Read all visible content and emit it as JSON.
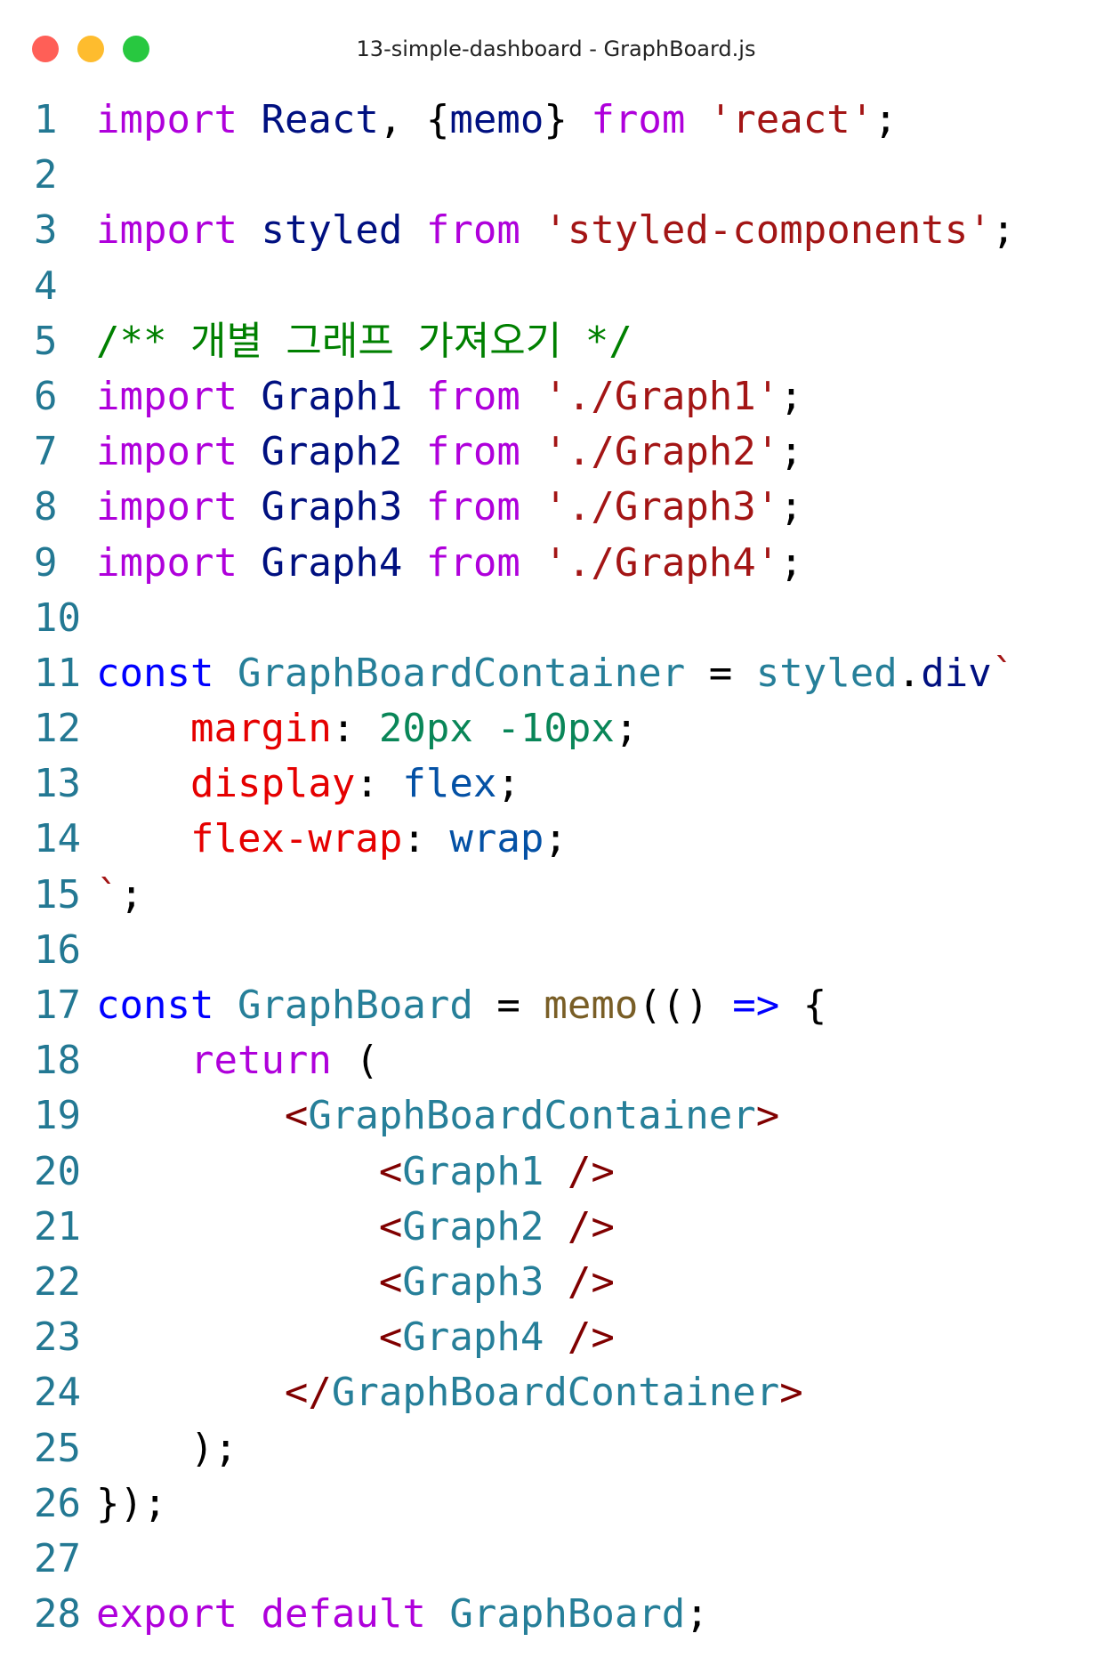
{
  "window": {
    "title": "13-simple-dashboard - GraphBoard.js",
    "controls": [
      {
        "name": "close-button",
        "color": "#FF5F57"
      },
      {
        "name": "minimize-button",
        "color": "#FEBC2E"
      },
      {
        "name": "maximize-button",
        "color": "#28C840"
      }
    ]
  },
  "colors": {
    "line_number": "#237893",
    "keyword": "#AF00DB",
    "declaration": "#0000FF",
    "identifier": "#001080",
    "component": "#267F99",
    "string": "#A31515",
    "comment": "#008000",
    "css_property": "#E50000",
    "css_value": "#0451A5",
    "number": "#098658",
    "function": "#795E26",
    "jsx_bracket": "#800000",
    "plain": "#000000"
  },
  "code_lines": [
    {
      "n": "1",
      "tokens": [
        [
          "import",
          "keyword"
        ],
        [
          " ",
          "plain"
        ],
        [
          "React",
          "identifier"
        ],
        [
          ", {",
          "plain"
        ],
        [
          "memo",
          "identifier"
        ],
        [
          "} ",
          "plain"
        ],
        [
          "from",
          "keyword"
        ],
        [
          " ",
          "plain"
        ],
        [
          "'react'",
          "string"
        ],
        [
          ";",
          "plain"
        ]
      ]
    },
    {
      "n": "2",
      "tokens": []
    },
    {
      "n": "3",
      "tokens": [
        [
          "import",
          "keyword"
        ],
        [
          " ",
          "plain"
        ],
        [
          "styled",
          "identifier"
        ],
        [
          " ",
          "plain"
        ],
        [
          "from",
          "keyword"
        ],
        [
          " ",
          "plain"
        ],
        [
          "'styled-components'",
          "string"
        ],
        [
          ";",
          "plain"
        ]
      ]
    },
    {
      "n": "4",
      "tokens": []
    },
    {
      "n": "5",
      "tokens": [
        [
          "/** 개별 그래프 가져오기 */",
          "comment"
        ]
      ]
    },
    {
      "n": "6",
      "tokens": [
        [
          "import",
          "keyword"
        ],
        [
          " ",
          "plain"
        ],
        [
          "Graph1",
          "identifier"
        ],
        [
          " ",
          "plain"
        ],
        [
          "from",
          "keyword"
        ],
        [
          " ",
          "plain"
        ],
        [
          "'./Graph1'",
          "string"
        ],
        [
          ";",
          "plain"
        ]
      ]
    },
    {
      "n": "7",
      "tokens": [
        [
          "import",
          "keyword"
        ],
        [
          " ",
          "plain"
        ],
        [
          "Graph2",
          "identifier"
        ],
        [
          " ",
          "plain"
        ],
        [
          "from",
          "keyword"
        ],
        [
          " ",
          "plain"
        ],
        [
          "'./Graph2'",
          "string"
        ],
        [
          ";",
          "plain"
        ]
      ]
    },
    {
      "n": "8",
      "tokens": [
        [
          "import",
          "keyword"
        ],
        [
          " ",
          "plain"
        ],
        [
          "Graph3",
          "identifier"
        ],
        [
          " ",
          "plain"
        ],
        [
          "from",
          "keyword"
        ],
        [
          " ",
          "plain"
        ],
        [
          "'./Graph3'",
          "string"
        ],
        [
          ";",
          "plain"
        ]
      ]
    },
    {
      "n": "9",
      "tokens": [
        [
          "import",
          "keyword"
        ],
        [
          " ",
          "plain"
        ],
        [
          "Graph4",
          "identifier"
        ],
        [
          " ",
          "plain"
        ],
        [
          "from",
          "keyword"
        ],
        [
          " ",
          "plain"
        ],
        [
          "'./Graph4'",
          "string"
        ],
        [
          ";",
          "plain"
        ]
      ]
    },
    {
      "n": "10",
      "tokens": []
    },
    {
      "n": "11",
      "tokens": [
        [
          "const",
          "declaration"
        ],
        [
          " ",
          "plain"
        ],
        [
          "GraphBoardContainer",
          "component"
        ],
        [
          " = ",
          "plain"
        ],
        [
          "styled",
          "component"
        ],
        [
          ".",
          "plain"
        ],
        [
          "div",
          "identifier"
        ],
        [
          "`",
          "string"
        ]
      ]
    },
    {
      "n": "12",
      "tokens": [
        [
          "    ",
          "plain"
        ],
        [
          "margin",
          "css_property"
        ],
        [
          ": ",
          "plain"
        ],
        [
          "20px -10px",
          "number"
        ],
        [
          ";",
          "plain"
        ]
      ]
    },
    {
      "n": "13",
      "tokens": [
        [
          "    ",
          "plain"
        ],
        [
          "display",
          "css_property"
        ],
        [
          ": ",
          "plain"
        ],
        [
          "flex",
          "css_value"
        ],
        [
          ";",
          "plain"
        ]
      ]
    },
    {
      "n": "14",
      "tokens": [
        [
          "    ",
          "plain"
        ],
        [
          "flex-wrap",
          "css_property"
        ],
        [
          ": ",
          "plain"
        ],
        [
          "wrap",
          "css_value"
        ],
        [
          ";",
          "plain"
        ]
      ]
    },
    {
      "n": "15",
      "tokens": [
        [
          "`",
          "string"
        ],
        [
          ";",
          "plain"
        ]
      ]
    },
    {
      "n": "16",
      "tokens": []
    },
    {
      "n": "17",
      "tokens": [
        [
          "const",
          "declaration"
        ],
        [
          " ",
          "plain"
        ],
        [
          "GraphBoard",
          "component"
        ],
        [
          " = ",
          "plain"
        ],
        [
          "memo",
          "function"
        ],
        [
          "(() ",
          "plain"
        ],
        [
          "=>",
          "declaration"
        ],
        [
          " {",
          "plain"
        ]
      ]
    },
    {
      "n": "18",
      "tokens": [
        [
          "    ",
          "plain"
        ],
        [
          "return",
          "keyword"
        ],
        [
          " (",
          "plain"
        ]
      ]
    },
    {
      "n": "19",
      "tokens": [
        [
          "        ",
          "plain"
        ],
        [
          "<",
          "jsx_bracket"
        ],
        [
          "GraphBoardContainer",
          "component"
        ],
        [
          ">",
          "jsx_bracket"
        ]
      ]
    },
    {
      "n": "20",
      "tokens": [
        [
          "            ",
          "plain"
        ],
        [
          "<",
          "jsx_bracket"
        ],
        [
          "Graph1",
          "component"
        ],
        [
          " />",
          "jsx_bracket"
        ]
      ]
    },
    {
      "n": "21",
      "tokens": [
        [
          "            ",
          "plain"
        ],
        [
          "<",
          "jsx_bracket"
        ],
        [
          "Graph2",
          "component"
        ],
        [
          " />",
          "jsx_bracket"
        ]
      ]
    },
    {
      "n": "22",
      "tokens": [
        [
          "            ",
          "plain"
        ],
        [
          "<",
          "jsx_bracket"
        ],
        [
          "Graph3",
          "component"
        ],
        [
          " />",
          "jsx_bracket"
        ]
      ]
    },
    {
      "n": "23",
      "tokens": [
        [
          "            ",
          "plain"
        ],
        [
          "<",
          "jsx_bracket"
        ],
        [
          "Graph4",
          "component"
        ],
        [
          " />",
          "jsx_bracket"
        ]
      ]
    },
    {
      "n": "24",
      "tokens": [
        [
          "        ",
          "plain"
        ],
        [
          "</",
          "jsx_bracket"
        ],
        [
          "GraphBoardContainer",
          "component"
        ],
        [
          ">",
          "jsx_bracket"
        ]
      ]
    },
    {
      "n": "25",
      "tokens": [
        [
          "    ",
          "plain"
        ],
        [
          ");",
          "plain"
        ]
      ]
    },
    {
      "n": "26",
      "tokens": [
        [
          "});",
          "plain"
        ]
      ]
    },
    {
      "n": "27",
      "tokens": []
    },
    {
      "n": "28",
      "tokens": [
        [
          "export",
          "keyword"
        ],
        [
          " ",
          "plain"
        ],
        [
          "default",
          "keyword"
        ],
        [
          " ",
          "plain"
        ],
        [
          "GraphBoard",
          "component"
        ],
        [
          ";",
          "plain"
        ]
      ]
    }
  ]
}
